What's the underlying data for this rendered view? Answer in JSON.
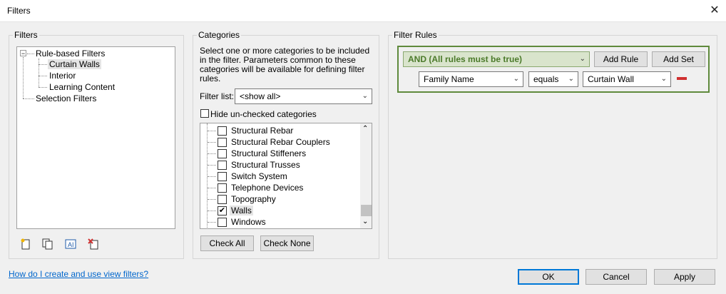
{
  "window": {
    "title": "Filters",
    "close_glyph": "✕"
  },
  "filters_panel": {
    "label": "Filters",
    "tree": {
      "root": "Rule-based Filters",
      "children": [
        "Curtain Walls",
        "Interior",
        "Learning Content"
      ],
      "selected": "Curtain Walls",
      "second_root": "Selection Filters",
      "expander": "−"
    },
    "toolbar_icons": [
      "new-filter-icon",
      "duplicate-filter-icon",
      "rename-filter-icon",
      "delete-filter-icon"
    ]
  },
  "categories_panel": {
    "label": "Categories",
    "description": "Select one or more categories to be included in the filter.  Parameters common to these categories will be available for defining filter rules.",
    "filter_list_label": "Filter list:",
    "filter_list_value": "<show all>",
    "hide_unchecked_label": "Hide un-checked categories",
    "items": [
      {
        "label": "Structural Rebar",
        "checked": false
      },
      {
        "label": "Structural Rebar Couplers",
        "checked": false
      },
      {
        "label": "Structural Stiffeners",
        "checked": false
      },
      {
        "label": "Structural Trusses",
        "checked": false
      },
      {
        "label": "Switch System",
        "checked": false
      },
      {
        "label": "Telephone Devices",
        "checked": false
      },
      {
        "label": "Topography",
        "checked": false
      },
      {
        "label": "Walls",
        "checked": true
      },
      {
        "label": "Windows",
        "checked": false
      }
    ],
    "check_all": "Check All",
    "check_none": "Check None"
  },
  "rules_panel": {
    "label": "Filter Rules",
    "operator": "AND (All rules must be true)",
    "add_rule": "Add Rule",
    "add_set": "Add Set",
    "rule": {
      "parameter": "Family Name",
      "condition": "equals",
      "value": "Curtain Wall"
    },
    "accent_color": "#5f8a3c",
    "remove_color": "#d03030"
  },
  "footer": {
    "help_link": "How do I create and use view filters?",
    "ok": "OK",
    "cancel": "Cancel",
    "apply": "Apply"
  }
}
